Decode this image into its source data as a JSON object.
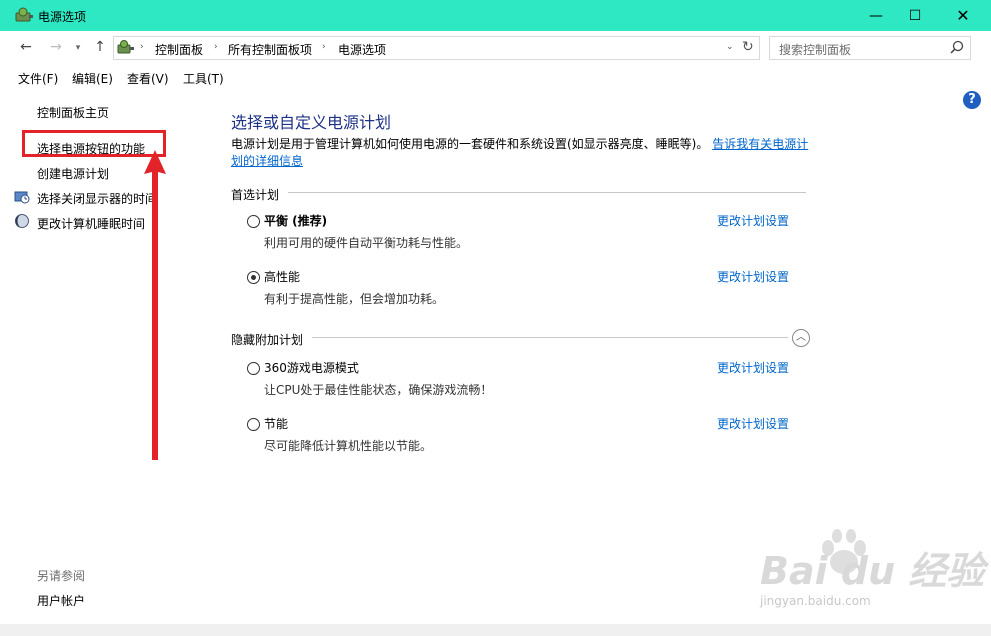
{
  "window": {
    "title": "电源选项",
    "minimize": "—",
    "maximize": "☐",
    "close": "✕"
  },
  "nav": {
    "back": "←",
    "forward": "→",
    "dropdown": "▾",
    "up": "↑",
    "breadcrumb": [
      "控制面板",
      "所有控制面板项",
      "电源选项"
    ],
    "separator": "›",
    "address_dropdown": "⌄",
    "refresh": "↻",
    "search_placeholder": "搜索控制面板"
  },
  "menubar": [
    "文件(F)",
    "编辑(E)",
    "查看(V)",
    "工具(T)"
  ],
  "sidebar": {
    "items": [
      {
        "label": "控制面板主页",
        "icon": ""
      },
      {
        "label": "选择电源按钮的功能",
        "icon": ""
      },
      {
        "label": "创建电源计划",
        "icon": ""
      },
      {
        "label": "选择关闭显示器的时间",
        "icon": "clock-monitor-icon"
      },
      {
        "label": "更改计算机睡眠时间",
        "icon": "moon-icon"
      }
    ],
    "see_also_label": "另请参阅",
    "see_also_items": [
      "用户帐户"
    ]
  },
  "help": "?",
  "main": {
    "heading": "选择或自定义电源计划",
    "description": "电源计划是用于管理计算机如何使用电源的一套硬件和系统设置(如显示器亮度、睡眠等)。",
    "description_link": "告诉我有关电源计划的详细信息",
    "preferred_label": "首选计划",
    "hidden_label": "隐藏附加计划",
    "collapse": "︿",
    "plans": [
      {
        "name": "平衡 (推荐)",
        "desc": "利用可用的硬件自动平衡功耗与性能。",
        "link": "更改计划设置",
        "checked": false,
        "bold": true
      },
      {
        "name": "高性能",
        "desc": "有利于提高性能，但会增加功耗。",
        "link": "更改计划设置",
        "checked": true,
        "bold": false
      },
      {
        "name": "360游戏电源模式",
        "desc": "让CPU处于最佳性能状态，确保游戏流畅！",
        "link": "更改计划设置",
        "checked": false,
        "bold": false
      },
      {
        "name": "节能",
        "desc": "尽可能降低计算机性能以节能。",
        "link": "更改计划设置",
        "checked": false,
        "bold": false
      }
    ]
  },
  "watermark": {
    "logo": "Bai du 经验",
    "url": "jingyan.baidu.com"
  },
  "colors": {
    "titlebar": "#2de8c2",
    "heading": "#1e3287",
    "link": "#0066cc",
    "annotation": "#e2232a"
  }
}
